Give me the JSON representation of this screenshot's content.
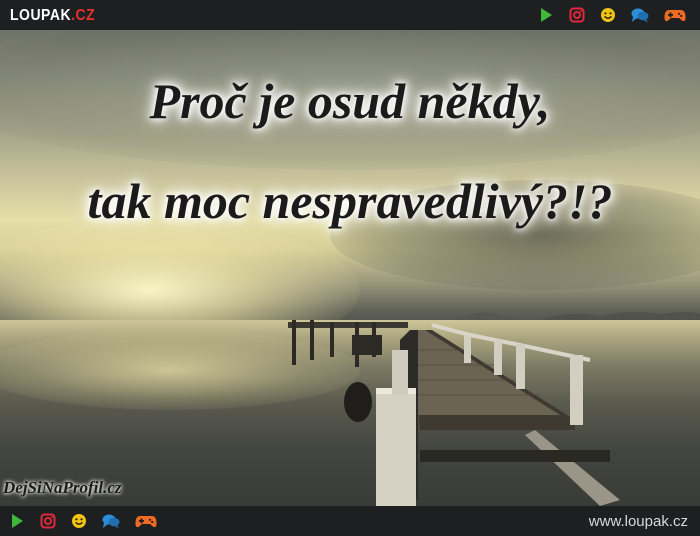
{
  "header": {
    "logo_main": "LOUPAK",
    "logo_tld": ".CZ"
  },
  "icons": [
    "play-icon",
    "instagram-icon",
    "smiley-icon",
    "chat-bubbles-icon",
    "gamepad-icon"
  ],
  "colors": {
    "bar_bg": "#1e1f21",
    "play": "#3fb83a",
    "instagram": "#e0283a",
    "smiley": "#f2c40f",
    "chat": "#2b8ed8",
    "gamepad": "#ef6b23",
    "logo_accent": "#e5322d"
  },
  "image": {
    "headline_line1": "Proč je osud někdy,",
    "headline_line2": "tak moc nespravedlivý?!?",
    "watermark": "DejSiNaProfil.cz"
  },
  "footer": {
    "site_url": "www.loupak.cz"
  }
}
